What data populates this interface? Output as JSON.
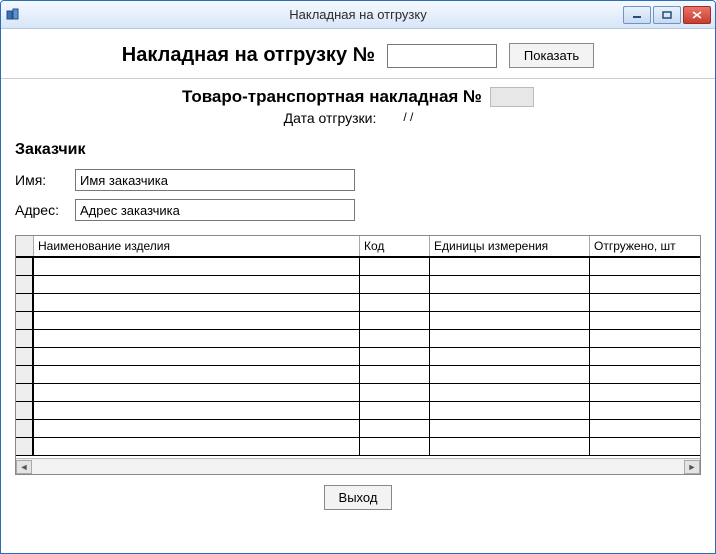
{
  "window": {
    "title": "Накладная на отгрузку"
  },
  "header": {
    "invoice_label": "Накладная на отгрузку №",
    "invoice_number": "",
    "show_button": "Показать"
  },
  "meta": {
    "ttn_label": "Товаро-транспортная накладная №",
    "ttn_number": "",
    "ship_date_label": "Дата отгрузки:",
    "ship_date_value": "/ /"
  },
  "customer": {
    "section_title": "Заказчик",
    "name_label": "Имя:",
    "name_value": "Имя заказчика",
    "address_label": "Адрес:",
    "address_value": "Адрес заказчика"
  },
  "grid": {
    "columns": {
      "name": "Наименование изделия",
      "code": "Код",
      "unit": "Единицы измерения",
      "qty": "Отгружено, шт"
    },
    "rows": [
      {
        "name": "",
        "code": "",
        "unit": "",
        "qty": ""
      },
      {
        "name": "",
        "code": "",
        "unit": "",
        "qty": ""
      },
      {
        "name": "",
        "code": "",
        "unit": "",
        "qty": ""
      },
      {
        "name": "",
        "code": "",
        "unit": "",
        "qty": ""
      },
      {
        "name": "",
        "code": "",
        "unit": "",
        "qty": ""
      },
      {
        "name": "",
        "code": "",
        "unit": "",
        "qty": ""
      },
      {
        "name": "",
        "code": "",
        "unit": "",
        "qty": ""
      },
      {
        "name": "",
        "code": "",
        "unit": "",
        "qty": ""
      },
      {
        "name": "",
        "code": "",
        "unit": "",
        "qty": ""
      },
      {
        "name": "",
        "code": "",
        "unit": "",
        "qty": ""
      },
      {
        "name": "",
        "code": "",
        "unit": "",
        "qty": ""
      }
    ]
  },
  "footer": {
    "exit_button": "Выход"
  }
}
